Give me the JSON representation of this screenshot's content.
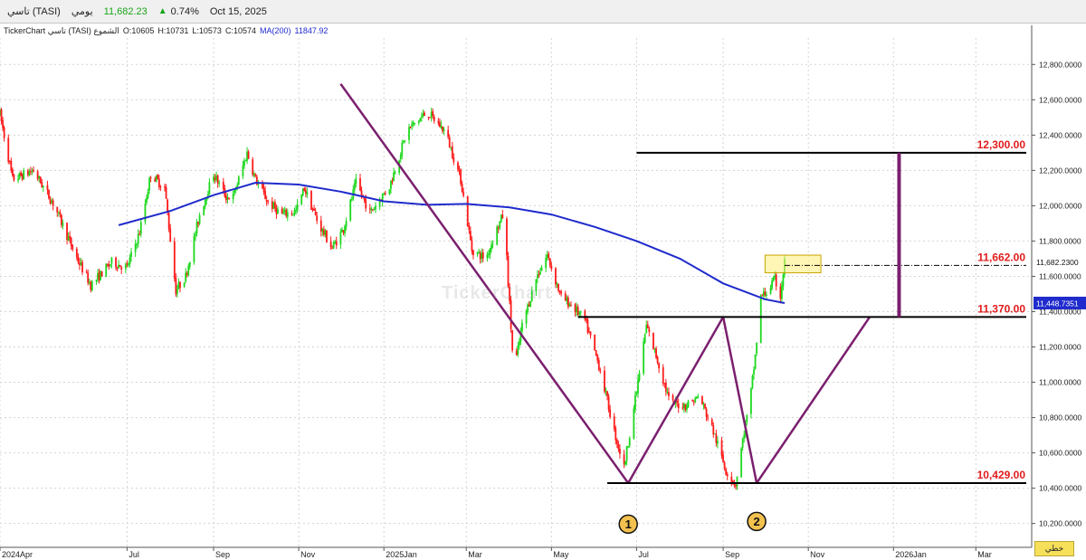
{
  "header": {
    "symbol": "تاسي (TASI)",
    "interval": "يومي",
    "price": "11,682.23",
    "change_pct": "0.74%",
    "date": "Oct 15, 2025"
  },
  "info": {
    "source": "TickerChart تاسي (TASI) الشموع",
    "open": "O:10605",
    "high": "H:10731",
    "low": "L:10573",
    "close": "C:10574",
    "ma_label": "MA(200)",
    "ma_value": "11847.92"
  },
  "watermark": "TickerChart",
  "pan_button": "خطي",
  "colors": {
    "up": "#1ed81e",
    "down": "#ff1a1a",
    "ma": "#1f2bcc",
    "pattern": "#7b1f6e",
    "level_label": "#e01b1b"
  },
  "chart_data": {
    "type": "candlestick",
    "x_tick_labels": [
      "2024Apr",
      "Jul",
      "Sep",
      "Nov",
      "2025Jan",
      "Mar",
      "May",
      "Jul",
      "Sep",
      "Nov",
      "2026Jan",
      "Mar"
    ],
    "y_ticks": [
      "12,800.0000",
      "12,600.0000",
      "12,400.0000",
      "12,200.0000",
      "12,000.0000",
      "11,800.0000",
      "11,600.0000",
      "11,400.0000",
      "11,200.0000",
      "11,000.0000",
      "10,800.0000",
      "10,600.0000",
      "10,400.0000",
      "10,200.0000"
    ],
    "y_tick_values": [
      12800,
      12600,
      12400,
      12200,
      12000,
      11800,
      11600,
      11400,
      11200,
      11000,
      10800,
      10600,
      10400,
      10200
    ],
    "ylim": [
      10065,
      12950
    ],
    "x_range": [
      "2024-04-01",
      "2026-04-10"
    ],
    "price_path": [
      [
        "2024-04-01",
        12520
      ],
      [
        "2024-04-10",
        12150
      ],
      [
        "2024-04-25",
        12200
      ],
      [
        "2024-05-10",
        12000
      ],
      [
        "2024-05-25",
        11720
      ],
      [
        "2024-06-05",
        11550
      ],
      [
        "2024-06-20",
        11680
      ],
      [
        "2024-07-01",
        11650
      ],
      [
        "2024-07-10",
        11850
      ],
      [
        "2024-07-18",
        12180
      ],
      [
        "2024-07-28",
        12100
      ],
      [
        "2024-08-05",
        11520
      ],
      [
        "2024-08-12",
        11600
      ],
      [
        "2024-08-22",
        11950
      ],
      [
        "2024-09-01",
        12180
      ],
      [
        "2024-09-10",
        12050
      ],
      [
        "2024-09-15",
        12050
      ],
      [
        "2024-09-25",
        12300
      ],
      [
        "2024-10-01",
        12150
      ],
      [
        "2024-10-10",
        12020
      ],
      [
        "2024-10-20",
        11950
      ],
      [
        "2024-10-30",
        11970
      ],
      [
        "2024-11-05",
        12100
      ],
      [
        "2024-11-15",
        11900
      ],
      [
        "2024-11-25",
        11760
      ],
      [
        "2024-12-03",
        11870
      ],
      [
        "2024-12-12",
        12130
      ],
      [
        "2024-12-22",
        11960
      ],
      [
        "2025-01-05",
        12110
      ],
      [
        "2025-01-18",
        12430
      ],
      [
        "2025-02-01",
        12530
      ],
      [
        "2025-02-14",
        12420
      ],
      [
        "2025-02-25",
        12150
      ],
      [
        "2025-03-05",
        11750
      ],
      [
        "2025-03-15",
        11700
      ],
      [
        "2025-03-22",
        11850
      ],
      [
        "2025-03-28",
        11960
      ],
      [
        "2025-04-04",
        11050
      ],
      [
        "2025-04-10",
        11320
      ],
      [
        "2025-04-20",
        11590
      ],
      [
        "2025-04-28",
        11720
      ],
      [
        "2025-05-08",
        11480
      ],
      [
        "2025-05-15",
        11440
      ],
      [
        "2025-05-25",
        11350
      ],
      [
        "2025-06-05",
        11070
      ],
      [
        "2025-06-15",
        10720
      ],
      [
        "2025-06-22",
        10520
      ],
      [
        "2025-07-01",
        10950
      ],
      [
        "2025-07-08",
        11320
      ],
      [
        "2025-07-15",
        11150
      ],
      [
        "2025-07-25",
        10880
      ],
      [
        "2025-08-05",
        10870
      ],
      [
        "2025-08-15",
        10920
      ],
      [
        "2025-08-25",
        10720
      ],
      [
        "2025-09-03",
        10500
      ],
      [
        "2025-09-10",
        10420
      ],
      [
        "2025-09-16",
        10720
      ],
      [
        "2025-09-20",
        10880
      ],
      [
        "2025-09-24",
        11150
      ],
      [
        "2025-09-28",
        11480
      ],
      [
        "2025-10-03",
        11520
      ],
      [
        "2025-10-08",
        11580
      ],
      [
        "2025-10-12",
        11490
      ],
      [
        "2025-10-15",
        11682
      ]
    ],
    "ma_series": {
      "name": "MA(200)",
      "points": [
        [
          "2024-06-25",
          11890
        ],
        [
          "2024-08-01",
          11970
        ],
        [
          "2024-09-01",
          12060
        ],
        [
          "2024-10-01",
          12130
        ],
        [
          "2024-11-01",
          12120
        ],
        [
          "2024-12-01",
          12080
        ],
        [
          "2025-01-01",
          12025
        ],
        [
          "2025-02-01",
          12005
        ],
        [
          "2025-03-01",
          12010
        ],
        [
          "2025-04-01",
          11990
        ],
        [
          "2025-05-01",
          11950
        ],
        [
          "2025-06-01",
          11880
        ],
        [
          "2025-07-01",
          11800
        ],
        [
          "2025-08-01",
          11700
        ],
        [
          "2025-09-01",
          11560
        ],
        [
          "2025-10-01",
          11470
        ],
        [
          "2025-10-15",
          11448.74
        ]
      ]
    },
    "current_price_tag": "11,682.2300",
    "current_price_value": 11682.23,
    "ma_price_tag": "11,448.7351",
    "ma_price_value": 11448.7351,
    "levels": [
      {
        "label": "12,300.00",
        "value": 12300,
        "from": "2025-07-01"
      },
      {
        "label": "11,662.00",
        "value": 11662,
        "from": "2025-10-15"
      },
      {
        "label": "11,370.00",
        "value": 11370,
        "from": "2025-05-20"
      },
      {
        "label": "10,429.00",
        "value": 10429,
        "from": "2025-06-10"
      }
    ],
    "pattern_lines": [
      [
        [
          "2024-12-01",
          12690
        ],
        [
          "2025-06-25",
          10429
        ]
      ],
      [
        [
          "2025-06-25",
          10429
        ],
        [
          "2025-09-01",
          11370
        ]
      ],
      [
        [
          "2025-09-01",
          11370
        ],
        [
          "2025-09-25",
          10429
        ]
      ],
      [
        [
          "2025-09-25",
          10429
        ],
        [
          "2025-12-15",
          11370
        ]
      ]
    ],
    "target_arrow": {
      "date": "2026-01-05",
      "from": 11370,
      "to": 12300
    },
    "highlight_box": {
      "from_date": "2025-10-01",
      "to_date": "2025-11-10",
      "low": 11620,
      "high": 11720
    },
    "markers": [
      {
        "label": "1",
        "date": "2025-06-25",
        "value": 10340
      },
      {
        "label": "2",
        "date": "2025-09-25",
        "value": 10355
      }
    ]
  }
}
